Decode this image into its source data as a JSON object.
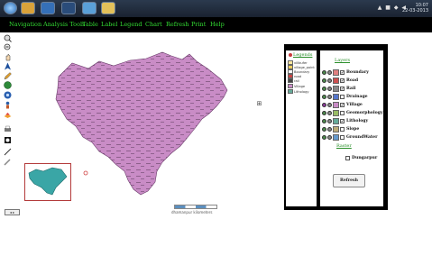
{
  "taskbar": {
    "clock_time": "10:07",
    "clock_date": "22-03-2013"
  },
  "menu": [
    {
      "label": "Navigation"
    },
    {
      "label": "Analysis Tools"
    },
    {
      "label": "Table"
    },
    {
      "label": "Label"
    },
    {
      "label": "Legend"
    },
    {
      "label": "Chart"
    },
    {
      "label": "Refresh"
    },
    {
      "label": "Print"
    },
    {
      "label": "Help"
    }
  ],
  "toolbar_icons": [
    "zoom-in-icon",
    "zoom-out-icon",
    "pan-icon",
    "north-arrow-icon",
    "pencil-icon",
    "globe-icon",
    "info-icon",
    "user-icon",
    "layers-icon",
    "printer-icon",
    "select-icon",
    "measure-icon",
    "eraser-icon"
  ],
  "map": {
    "fill_color": "#c98cc6",
    "mini_fill_color": "#3aa6a6",
    "scale_label": "dhamanpur kilometers",
    "zoom_label": "◂ ▸"
  },
  "legend_panel": {
    "left_title": "Legends",
    "left_items": [
      {
        "label": "villbufer",
        "color": "#ffe8a0"
      },
      {
        "label": "village_point",
        "color": "#f0d060"
      },
      {
        "label": "Boundary",
        "color": "#ffffff"
      },
      {
        "label": "road",
        "color": "#cc4444"
      },
      {
        "label": "rail",
        "color": "#444444"
      },
      {
        "label": "Village",
        "color": "#c98cc6"
      },
      {
        "label": "Lithology",
        "color": "#66aa99"
      }
    ],
    "right_title": "Layers",
    "layers": [
      {
        "name": "Boundary",
        "color": "#e08080",
        "checked": "✔"
      },
      {
        "name": "Road",
        "color": "#cc5050",
        "checked": "✔"
      },
      {
        "name": "Rail",
        "color": "#888888",
        "checked": "✔"
      },
      {
        "name": "Drainage",
        "color": "#5577cc",
        "checked": ""
      },
      {
        "name": "Village",
        "color": "#c98cc6",
        "checked": "✔"
      },
      {
        "name": "Geomorphology",
        "color": "#99bb66",
        "checked": ""
      },
      {
        "name": "Lithology",
        "color": "#66aa99",
        "checked": "✔"
      },
      {
        "name": "Slope",
        "color": "#bbaa77",
        "checked": ""
      },
      {
        "name": "GroundWater",
        "color": "#6699cc",
        "checked": ""
      }
    ],
    "basemap_title": "Raster",
    "basemap_item": "Dungarpur",
    "refresh_label": "Refresh"
  }
}
